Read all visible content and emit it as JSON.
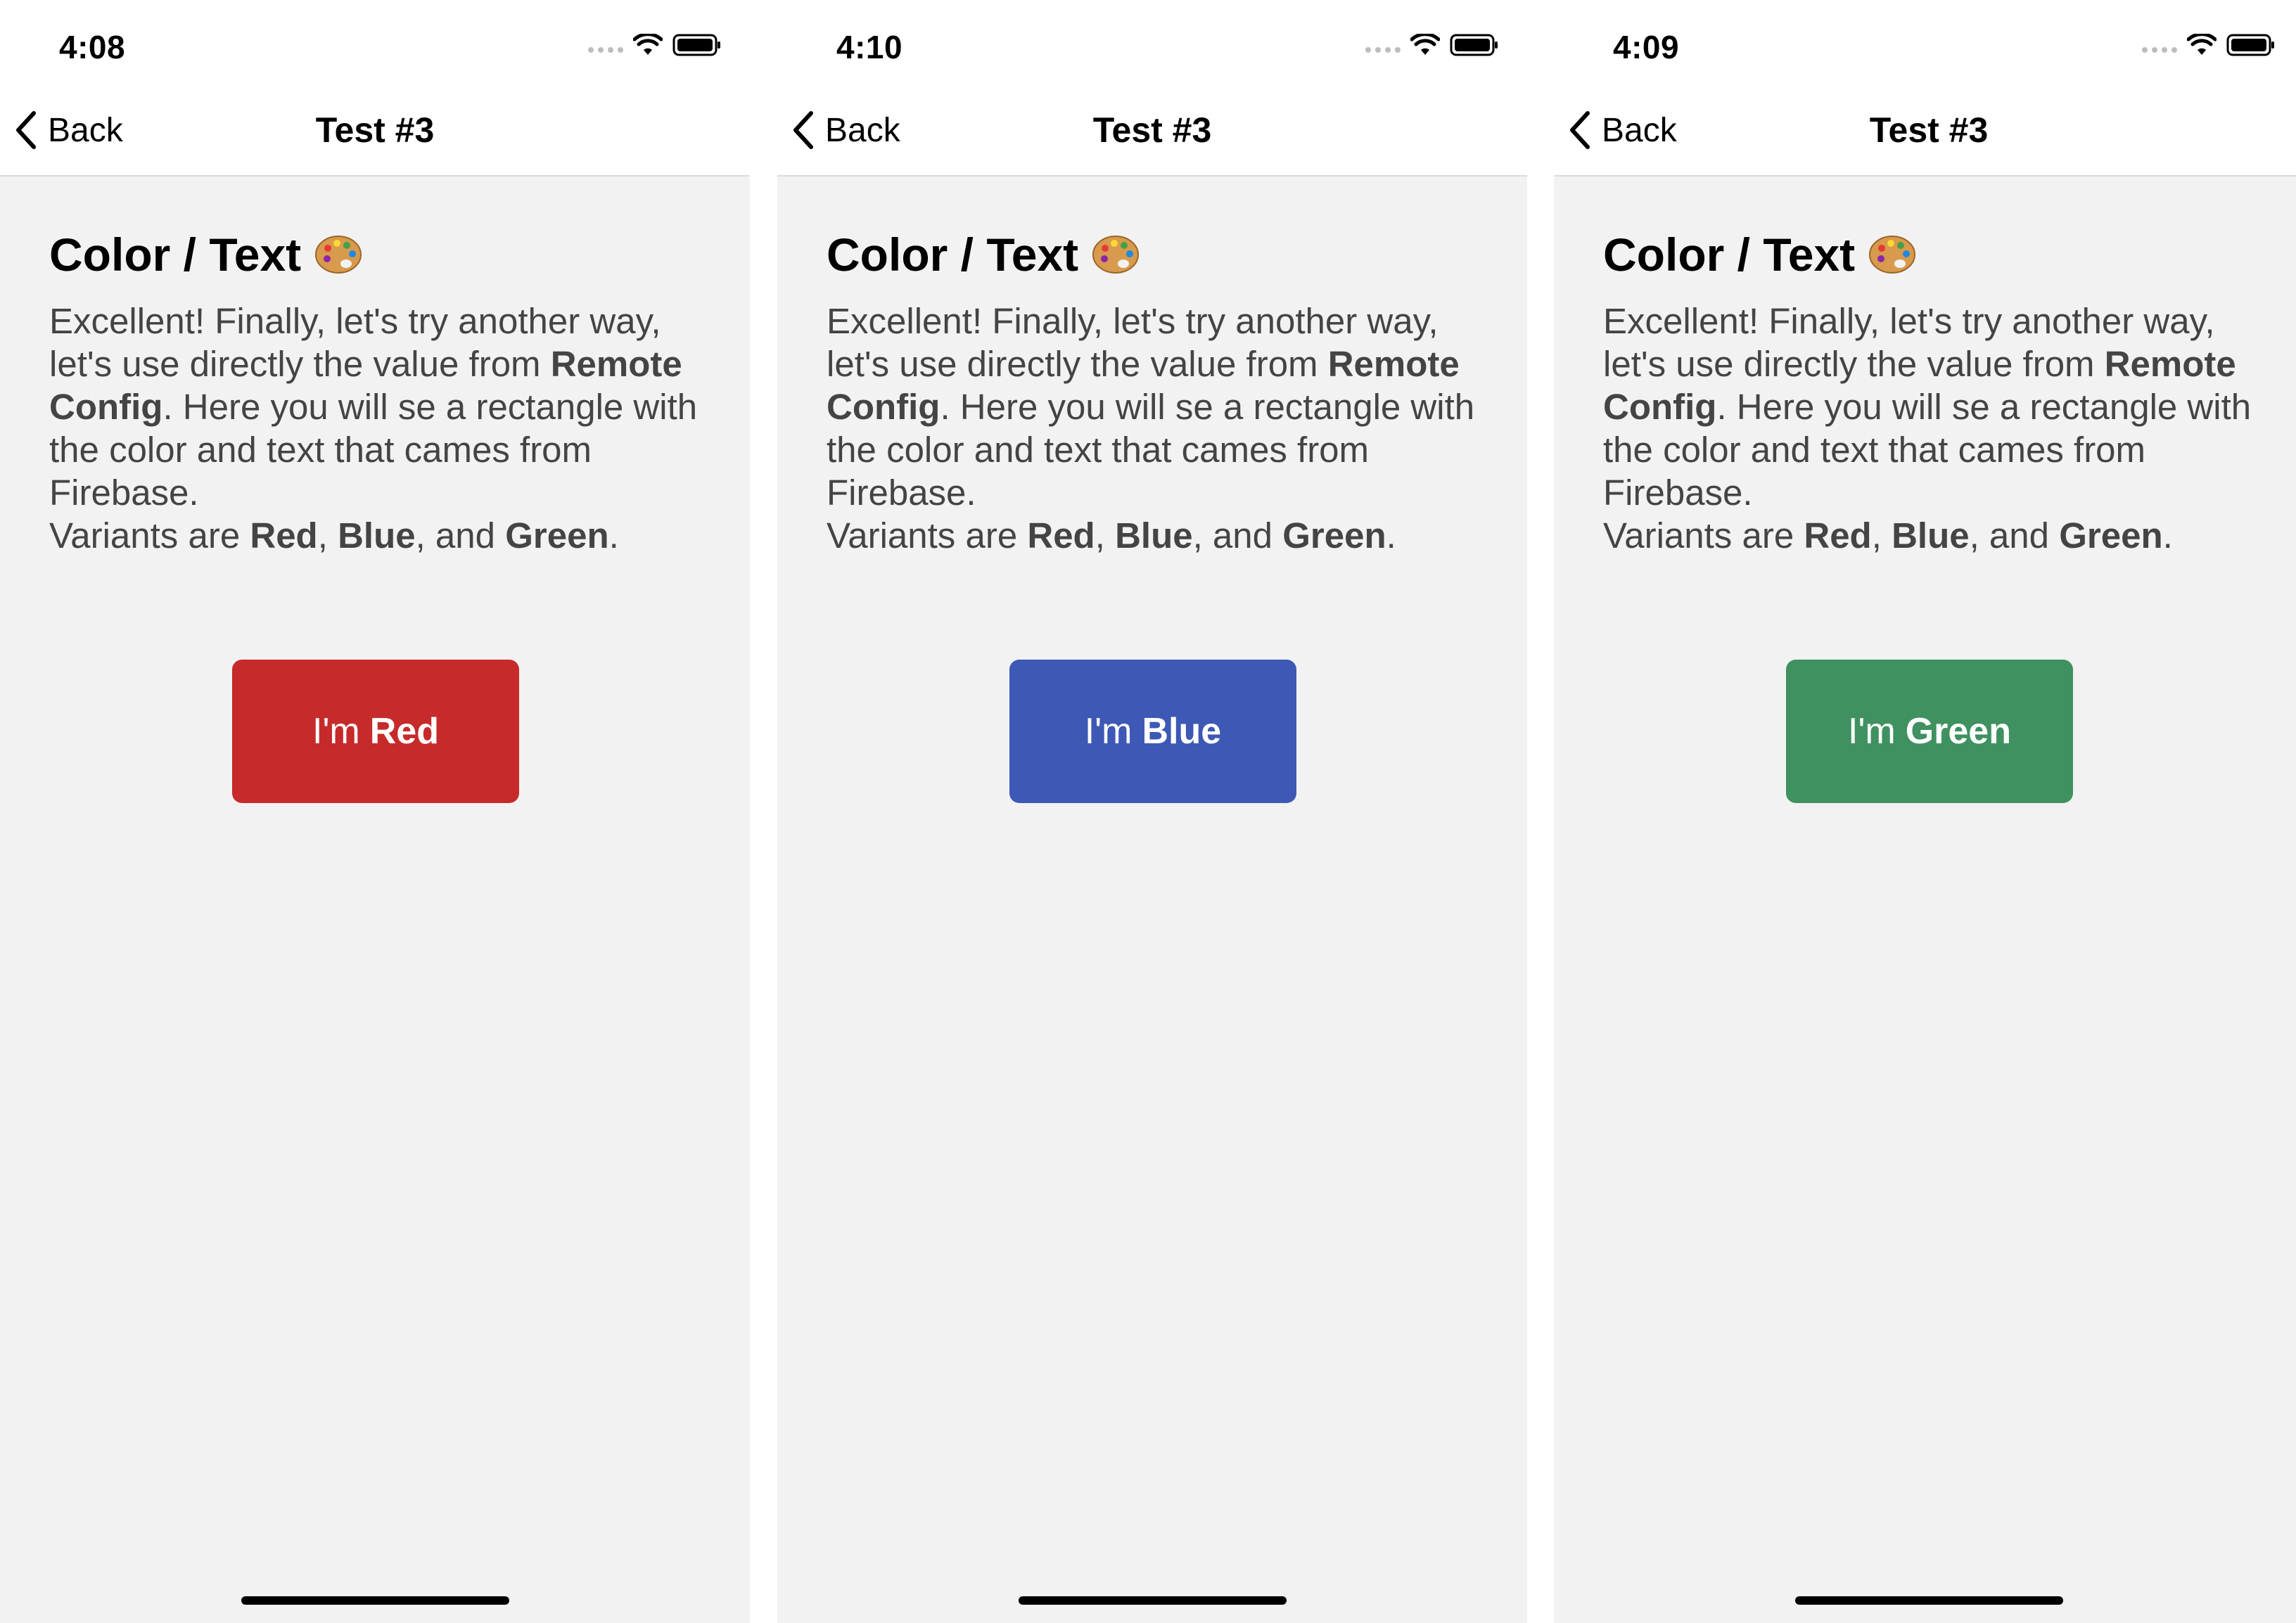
{
  "screens": [
    {
      "time": "4:08",
      "nav": {
        "back_label": "Back",
        "title": "Test #3"
      },
      "heading": "Color / Text",
      "body": {
        "intro": "Excellent! Finally, let's try another way, let's use directly the value from ",
        "remote_config": "Remote Config",
        "after": ". Here you will se a rectangle with the color and text that cames from Firebase.",
        "variants_prefix": "Variants are ",
        "variant_red": "Red",
        "sep1": ", ",
        "variant_blue": "Blue",
        "sep2": ", and ",
        "variant_green": "Green",
        "period": "."
      },
      "button": {
        "prefix": "I'm",
        "name": "Red",
        "color": "#c62a2a"
      }
    },
    {
      "time": "4:10",
      "nav": {
        "back_label": "Back",
        "title": "Test #3"
      },
      "heading": "Color / Text",
      "body": {
        "intro": "Excellent! Finally, let's try another way, let's use directly the value from ",
        "remote_config": "Remote Config",
        "after": ". Here you will se a rectangle with the color and text that cames from Firebase.",
        "variants_prefix": "Variants are ",
        "variant_red": "Red",
        "sep1": ", ",
        "variant_blue": "Blue",
        "sep2": ", and ",
        "variant_green": "Green",
        "period": "."
      },
      "button": {
        "prefix": "I'm",
        "name": "Blue",
        "color": "#3d58b5"
      }
    },
    {
      "time": "4:09",
      "nav": {
        "back_label": "Back",
        "title": "Test #3"
      },
      "heading": "Color / Text",
      "body": {
        "intro": "Excellent! Finally, let's try another way, let's use directly the value from ",
        "remote_config": "Remote Config",
        "after": ". Here you will se a rectangle with the color and text that cames from Firebase.",
        "variants_prefix": "Variants are ",
        "variant_red": "Red",
        "sep1": ", ",
        "variant_blue": "Blue",
        "sep2": ", and ",
        "variant_green": "Green",
        "period": "."
      },
      "button": {
        "prefix": "I'm",
        "name": "Green",
        "color": "#3f9160"
      }
    }
  ],
  "icons": {
    "signal": "cellular-signal-icon",
    "wifi": "wifi-icon",
    "battery": "battery-icon",
    "back": "chevron-left-icon",
    "palette": "artist-palette-icon"
  }
}
